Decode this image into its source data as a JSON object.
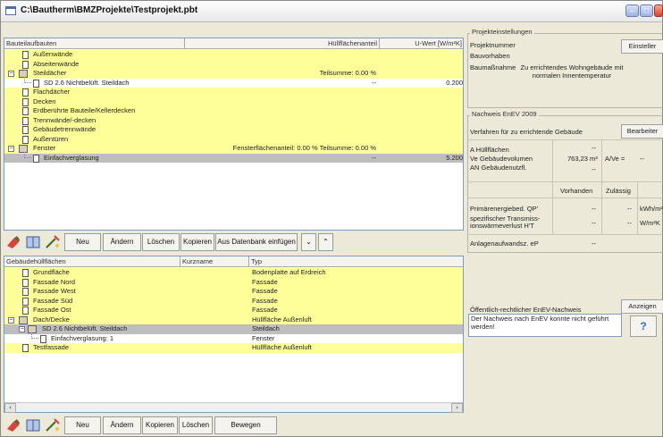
{
  "window": {
    "title": "C:\\Bautherm\\BMZProjekte\\Testprojekt.pbt"
  },
  "upper_grid": {
    "headers": [
      "Bauteilaufbauten",
      "Hüllflächenanteil",
      "U-Wert [W/m²K]"
    ],
    "rows": [
      {
        "label": "Außenwände",
        "mid": "",
        "value": ""
      },
      {
        "label": "Abseitenwände",
        "mid": "",
        "value": ""
      },
      {
        "label": "Steildächer",
        "mid": "Teilsumme: 0.00 %",
        "value": ""
      },
      {
        "label": "SD 2.6 Nichtbelüft. Steildach",
        "mid": "--",
        "value": "0.200"
      },
      {
        "label": "Flachdächer",
        "mid": "",
        "value": ""
      },
      {
        "label": "Decken",
        "mid": "",
        "value": ""
      },
      {
        "label": "Erdberührte Bauteile/Kellerdecken",
        "mid": "",
        "value": ""
      },
      {
        "label": "Trennwände/-decken",
        "mid": "",
        "value": ""
      },
      {
        "label": "Gebäudetrennwände",
        "mid": "",
        "value": ""
      },
      {
        "label": "Außentüren",
        "mid": "",
        "value": ""
      },
      {
        "label": "Fenster",
        "mid": "Fensterflächenanteil: 0.00 %   Teilsumme: 0.00 %",
        "value": ""
      },
      {
        "label": "Einfachverglasung",
        "mid": "--",
        "value": "5.200"
      }
    ]
  },
  "upper_toolbar": {
    "buttons": [
      "Neu",
      "Ändern",
      "Löschen",
      "Kopieren",
      "Aus Datenbank einfügen"
    ]
  },
  "lower_grid": {
    "headers": [
      "Gebäudehüllflächen",
      "Kurzname",
      "Typ"
    ],
    "rows": [
      {
        "label": "Grundfläche",
        "short": "",
        "type": "Bodenplatte auf Erdreich"
      },
      {
        "label": "Fassade Nord",
        "short": "",
        "type": "Fassade"
      },
      {
        "label": "Fassade West",
        "short": "",
        "type": "Fassade"
      },
      {
        "label": "Fassade Süd",
        "short": "",
        "type": "Fassade"
      },
      {
        "label": "Fassade Ost",
        "short": "",
        "type": "Fassade"
      },
      {
        "label": "Dach/Decke",
        "short": "",
        "type": "Hüllfläche Außenluft"
      },
      {
        "label": "SD 2.6 Nichtbelüft. Steildach",
        "short": "",
        "type": "Steildach"
      },
      {
        "label": "Einfachverglasung: 1",
        "short": "",
        "type": "Fenster"
      },
      {
        "label": "Testfassade",
        "short": "",
        "type": "Hüllfläche Außenluft"
      }
    ]
  },
  "lower_toolbar": {
    "buttons": [
      "Neu",
      "Ändern",
      "Kopieren",
      "Löschen",
      "Bewegen"
    ]
  },
  "project": {
    "group_title": "Projekteinstellungen",
    "settings_button": "Einsteller",
    "projektnummer": "Projektnummer",
    "bauvorhaben": "Bauvorhaben",
    "baumassnahme_label": "Baumaßnahme",
    "baumassnahme_value": "Zu errichtendes Wohngebäude mit normalen Innentemperatur"
  },
  "enev": {
    "group_title": "Nachweis EnEV 2009",
    "procedure": "Verfahren für zu errichtende Gebäude",
    "edit_button": "Bearbeiter",
    "a_label": "A  Hüllflächen",
    "a_value": "--",
    "ve_label": "Ve  Gebäudevolumen",
    "ve_value": "763,23 m³",
    "ave_label": "A/Ve =",
    "ave_value": "--",
    "an_label": "AN Gebäudenutzfl.",
    "an_value": "--",
    "col_vorhanden": "Vorhanden",
    "col_zulaessig": "Zulässig",
    "qp_label": "Primärenergiebed. QP'",
    "qp_vorhanden": "--",
    "qp_zulaessig": "--",
    "qp_unit": "kWh/m²",
    "ht_label": "spezifischer Transmiss-ionswärmeverlust H'T",
    "ht_vorhanden": "--",
    "ht_zulaessig": "--",
    "ht_unit": "W/m²K",
    "ep_label": "Anlagenaufwandsz. eP",
    "ep_value": "--"
  },
  "public": {
    "label": "Öffentlich-rechtlicher EnEV-Nachweis",
    "show_button": "Anzeigen",
    "message": "Der Nachweis nach EnEV konnte nicht geführt werden!",
    "help_glyph": "?"
  },
  "colors": {
    "highlight": "#ffff99",
    "selected": "#bebebe"
  }
}
